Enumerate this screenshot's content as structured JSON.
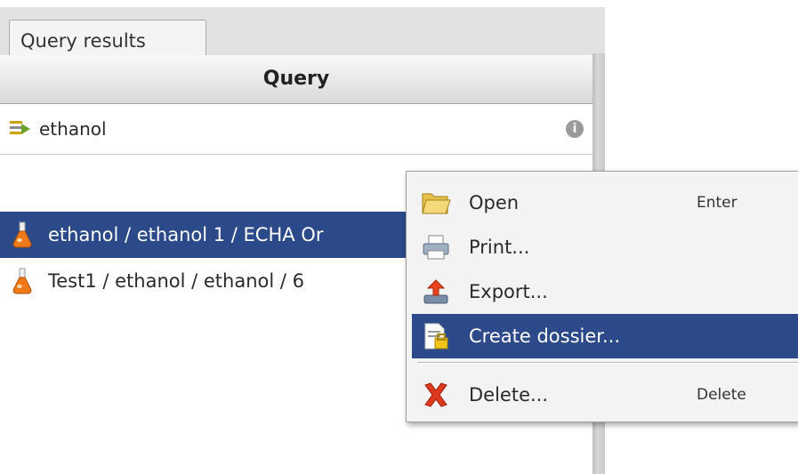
{
  "tabs": [
    {
      "label": "Query results"
    }
  ],
  "query_panel": {
    "header": "Query",
    "query_text": "ethanol",
    "query_icon": "filter-arrow-icon",
    "clear_icon": "clear-info-icon"
  },
  "results": [
    {
      "label": "ethanol / ethanol 1 / ECHA Or",
      "icon": "flask-icon",
      "selected": true
    },
    {
      "label": "Test1 / ethanol / ethanol / 6",
      "icon": "flask-icon",
      "selected": false
    }
  ],
  "context_menu": {
    "items": [
      {
        "label": "Open",
        "shortcut": "Enter",
        "icon": "folder-open-icon"
      },
      {
        "label": "Print...",
        "shortcut": "",
        "icon": "printer-icon"
      },
      {
        "label": "Export...",
        "shortcut": "",
        "icon": "export-icon"
      },
      {
        "label": "Create dossier...",
        "shortcut": "",
        "icon": "create-dossier-icon",
        "highlighted": true
      },
      {
        "label": "Delete...",
        "shortcut": "Delete",
        "icon": "delete-x-icon"
      }
    ]
  },
  "colors": {
    "selection": "#2c4a8a",
    "menu_bg": "#f3f3f3",
    "delete_red": "#e03a1e"
  }
}
